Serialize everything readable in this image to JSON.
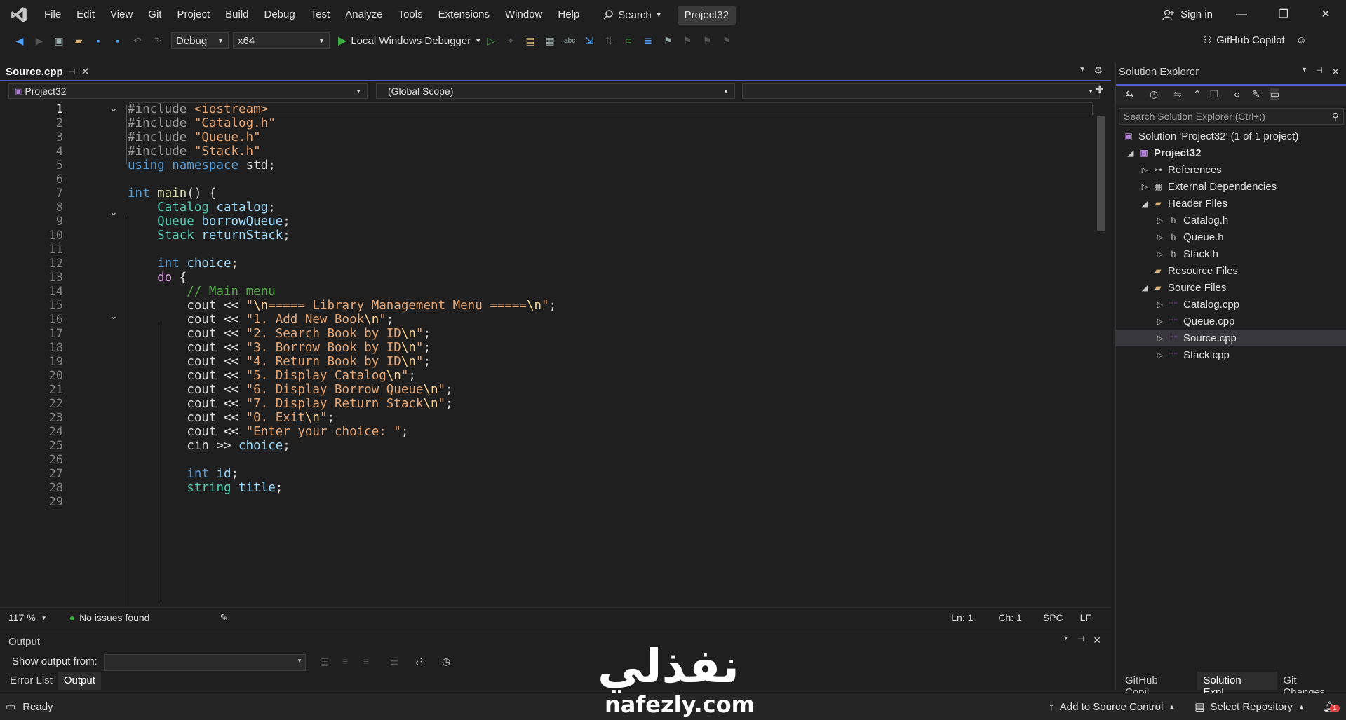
{
  "menu": [
    "File",
    "Edit",
    "View",
    "Git",
    "Project",
    "Build",
    "Debug",
    "Test",
    "Analyze",
    "Tools",
    "Extensions",
    "Window",
    "Help"
  ],
  "search_label": "Search",
  "project_title": "Project32",
  "signin_label": "Sign in",
  "window_buttons": {
    "minimize": "—",
    "restore": "❐",
    "close": "✕"
  },
  "toolbar": {
    "config": "Debug",
    "platform": "x64",
    "debugger": "Local Windows Debugger",
    "copilot": "GitHub Copilot"
  },
  "editor": {
    "tab_label": "Source.cpp",
    "nav_project": "Project32",
    "nav_scope": "(Global Scope)",
    "zoom": "117 %",
    "issues": "No issues found",
    "ln": "Ln: 1",
    "ch": "Ch: 1",
    "spc": "SPC",
    "lf": "LF",
    "line_numbers": [
      "1",
      "2",
      "3",
      "4",
      "5",
      "6",
      "7",
      "8",
      "9",
      "10",
      "11",
      "12",
      "13",
      "14",
      "15",
      "16",
      "17",
      "18",
      "19",
      "20",
      "21",
      "22",
      "23",
      "24",
      "25",
      "26",
      "27",
      "28",
      "29"
    ]
  },
  "output": {
    "title": "Output",
    "show_from": "Show output from:",
    "tab_error_list": "Error List",
    "tab_output": "Output"
  },
  "solution_explorer": {
    "title": "Solution Explorer",
    "search_placeholder": "Search Solution Explorer (Ctrl+;)",
    "solution": "Solution 'Project32' (1 of 1 project)",
    "project": "Project32",
    "references": "References",
    "external_deps": "External Dependencies",
    "header_files": "Header Files",
    "header_items": [
      "Catalog.h",
      "Queue.h",
      "Stack.h"
    ],
    "resource_files": "Resource Files",
    "source_files": "Source Files",
    "source_items": [
      "Catalog.cpp",
      "Queue.cpp",
      "Source.cpp",
      "Stack.cpp"
    ],
    "tabs": [
      "GitHub Copil...",
      "Solution Expl...",
      "Git Changes"
    ]
  },
  "statusbar": {
    "ready": "Ready",
    "add_source_control": "Add to Source Control",
    "select_repository": "Select Repository",
    "notifications": "1"
  },
  "watermark": {
    "arabic": "نفذلي",
    "latin": "nafezly.com"
  }
}
